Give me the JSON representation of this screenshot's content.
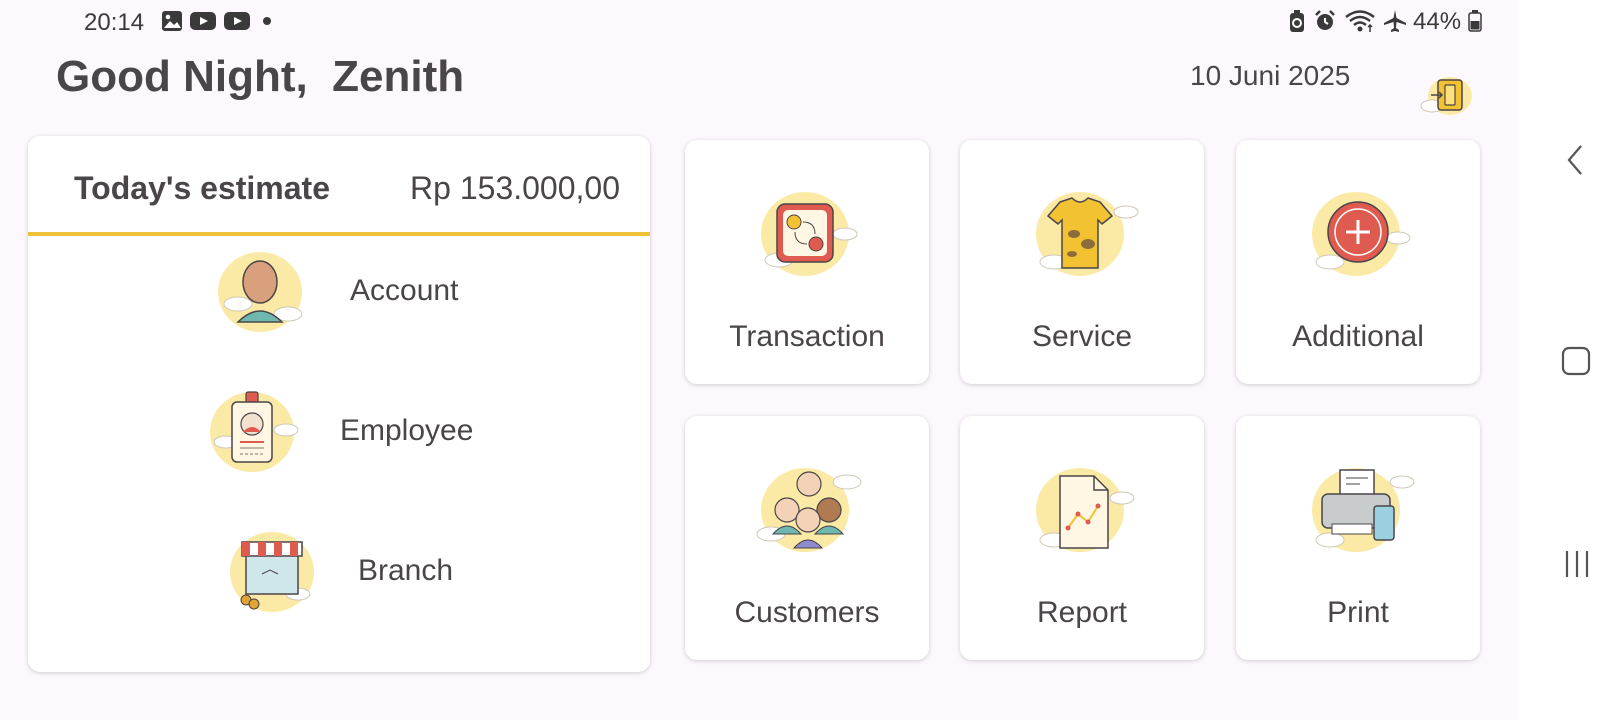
{
  "status_bar": {
    "time": "20:14",
    "left_icons": [
      "gallery-icon",
      "youtube-icon",
      "youtube-icon",
      "dot-icon"
    ],
    "right_icons": [
      "battery-saver-icon",
      "alarm-icon",
      "wifi-icon",
      "airplane-icon"
    ],
    "battery": "44%"
  },
  "header": {
    "greeting": "Good Night,  Zenith",
    "date": "10 Juni 2025",
    "exit_icon": "exit-door-icon"
  },
  "estimate": {
    "label": "Today's estimate",
    "value": "Rp 153.000,00"
  },
  "menu": {
    "items": [
      {
        "label": "Account",
        "icon": "person-avatar-icon"
      },
      {
        "label": "Employee",
        "icon": "id-card-icon"
      },
      {
        "label": "Branch",
        "icon": "store-icon"
      }
    ]
  },
  "tiles": [
    {
      "label": "Transaction",
      "icon": "money-exchange-icon"
    },
    {
      "label": "Service",
      "icon": "stained-shirt-icon"
    },
    {
      "label": "Additional",
      "icon": "plus-circle-icon"
    },
    {
      "label": "Customers",
      "icon": "people-group-icon"
    },
    {
      "label": "Report",
      "icon": "report-document-icon"
    },
    {
      "label": "Print",
      "icon": "printer-icon"
    }
  ],
  "colors": {
    "background": "#fdf8fd",
    "accent": "#efc03a",
    "text": "#4a4548",
    "icon_blob": "#fbeaa5"
  },
  "nav_bar": {
    "icons": [
      "back-chevron-icon",
      "home-square-icon",
      "recents-icon"
    ]
  }
}
